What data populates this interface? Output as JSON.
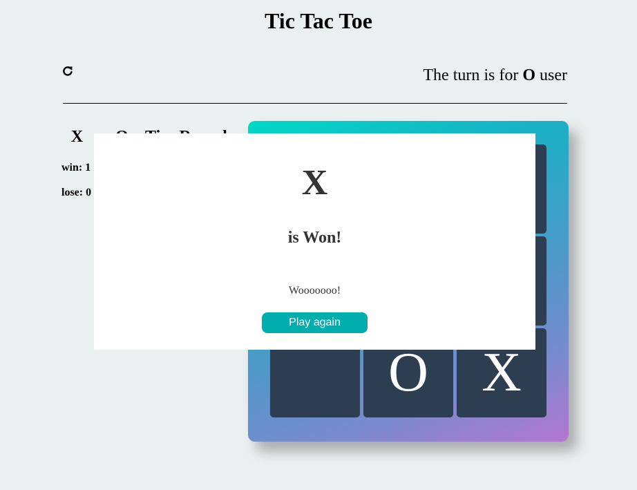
{
  "title": "Tic Tac Toe",
  "header": {
    "reset_icon": "refresh-icon",
    "turn_prefix": "The turn is for",
    "turn_player": "O",
    "turn_suffix": "user"
  },
  "scoreboard": {
    "headers": [
      "X",
      "O",
      "Tie",
      "Round"
    ],
    "win_label": "win: 1",
    "lose_label": "lose: 0"
  },
  "board": {
    "cells": [
      "",
      "",
      "",
      "",
      "",
      "",
      "",
      "O",
      "X"
    ]
  },
  "modal": {
    "winner": "X",
    "result_text": "is Won!",
    "message": "Wooooooo!",
    "button_label": "Play again"
  },
  "colors": {
    "background": "#eaeff0",
    "cell": "#2c3e4f",
    "button": "#00aeae"
  }
}
